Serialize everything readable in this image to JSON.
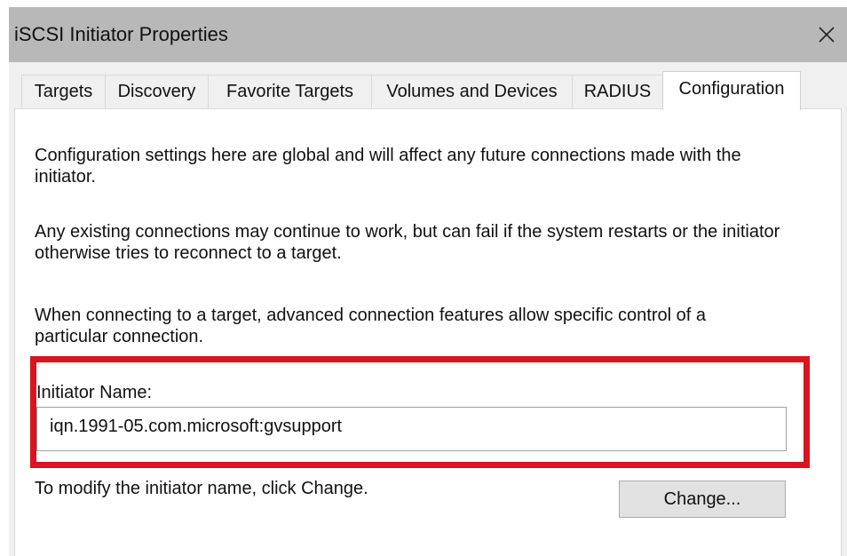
{
  "window": {
    "title": "iSCSI Initiator Properties",
    "close_glyph": "✕"
  },
  "tabs": [
    {
      "label": "Targets"
    },
    {
      "label": "Discovery"
    },
    {
      "label": "Favorite Targets"
    },
    {
      "label": "Volumes and Devices"
    },
    {
      "label": "RADIUS"
    },
    {
      "label": "Configuration",
      "selected": true
    }
  ],
  "configuration": {
    "paragraph_1": "Configuration settings here are global and will affect any future connections made with the initiator.",
    "paragraph_2": "Any existing connections may continue to work, but can fail if the system restarts or the initiator otherwise tries to reconnect to a target.",
    "paragraph_3": "When connecting to a target, advanced connection features allow specific control of a particular connection.",
    "initiator_name_label": "Initiator Name:",
    "initiator_name_value": "iqn.1991-05.com.microsoft:gvsupport",
    "modify_text": "To modify the initiator name, click Change.",
    "change_button_label": "Change..."
  },
  "colors": {
    "highlight_border": "#d9141c",
    "titlebar_bg": "#b8b8b8",
    "dialog_bg": "#f0f0f0"
  },
  "icons": {
    "close": "close-icon"
  }
}
